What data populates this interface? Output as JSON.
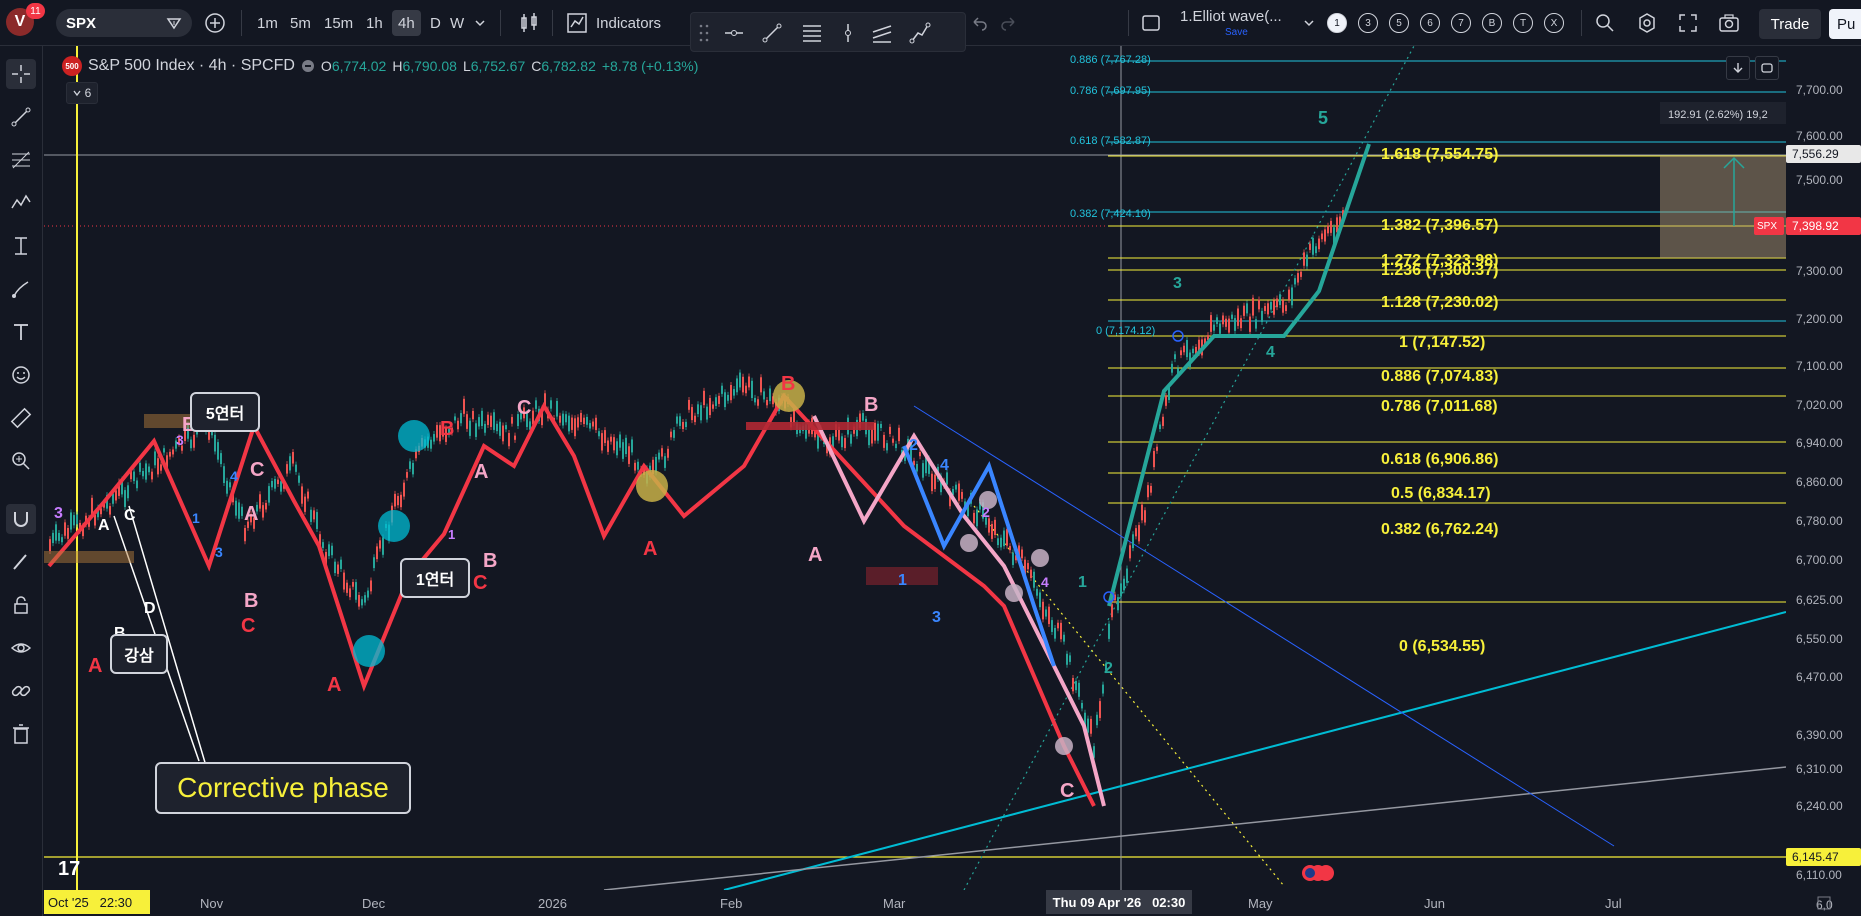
{
  "topbar": {
    "avatar_letter": "V",
    "notification_count": "11",
    "symbol": "SPX",
    "timeframes": [
      "1m",
      "5m",
      "15m",
      "1h",
      "4h",
      "D",
      "W"
    ],
    "active_timeframe": "4h",
    "indicators_label": "Indicators",
    "layout_name": "1.Elliot wave(...",
    "layout_save": "Save",
    "layout_slots": [
      "1",
      "3",
      "5",
      "6",
      "7",
      "B",
      "T",
      "X"
    ],
    "trade_label": "Trade",
    "publish_label": "Pu"
  },
  "legend": {
    "badge": "500",
    "title": "S&P 500 Index · 4h · SPCFD",
    "o_key": "O",
    "o_val": "6,774.02",
    "h_key": "H",
    "h_val": "6,790.08",
    "l_key": "L",
    "l_val": "6,752.67",
    "c_key": "C",
    "c_val": "6,782.82",
    "change": "+8.78 (+0.13%)",
    "collapse_count": "6"
  },
  "price_scale": {
    "ticks": [
      "7,700.00",
      "7,600.00",
      "7,500.00",
      "7,300.00",
      "7,200.00",
      "7,100.00",
      "7,020.00",
      "6,940.00",
      "6,860.00",
      "6,780.00",
      "6,700.00",
      "6,625.00",
      "6,550.00",
      "6,470.00",
      "6,390.00",
      "6,310.00",
      "6,240.00",
      "6,110.00"
    ],
    "tag_crosshair": "7,556.29",
    "tag_symbol": "SPX",
    "tag_last": "7,398.92",
    "tag_line": "6,145.47",
    "tag_bottom": "6,0"
  },
  "time_scale": {
    "labels": [
      "Nov",
      "Dec",
      "2026",
      "Feb",
      "Mar",
      "May",
      "Jun",
      "Jul"
    ],
    "left_label": "Oct '25   22:30",
    "cursor_label": "Thu 09 Apr '26   02:30"
  },
  "fib_extension": {
    "levels": [
      "1.618 (7,554.75)",
      "1.382 (7,396.57)",
      "1.272 (7,323.98)",
      "1.236 (7,300.37)",
      "1.128 (7,230.02)",
      "1 (7,147.52)",
      "0.886 (7,074.83)",
      "0.786 (7,011.68)",
      "0.618 (6,906.86)",
      "0.5 (6,834.17)",
      "0.382 (6,762.24)",
      "0 (6,534.55)"
    ],
    "color": "#f7f03a"
  },
  "fib_retrace": {
    "levels": [
      "0.886 (7,767.28)",
      "0.786 (7,697.95)",
      "0.618 (7,582.87)",
      "0.382 (7,424.10)",
      "0 (7,174.12)"
    ],
    "color": "#22c3dc"
  },
  "measure_label": "192.91 (2.62%) 19,2",
  "annotations": {
    "corrective": "Corrective phase",
    "entry5": "5연터",
    "entry1": "1연터",
    "gangsam": "강삼"
  },
  "wave_labels": {
    "a": "A",
    "b": "B",
    "c": "C",
    "d": "D",
    "e": "E",
    "n1": "1",
    "n2": "2",
    "n3": "3",
    "n4": "4",
    "n5": "5"
  }
}
